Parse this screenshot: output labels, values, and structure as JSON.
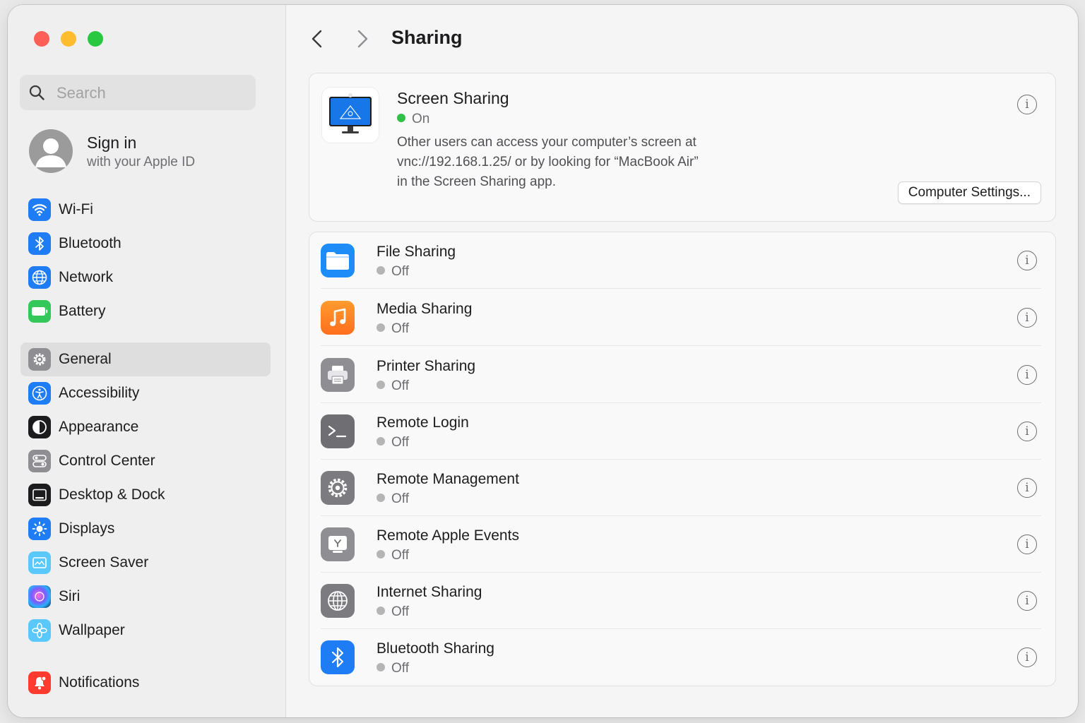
{
  "search": {
    "placeholder": "Search"
  },
  "account": {
    "name": "Sign in",
    "sub": "with your Apple ID"
  },
  "sidebar": {
    "items": [
      {
        "label": "Wi-Fi",
        "icon": "wifi-icon",
        "color": "#1e7cf5"
      },
      {
        "label": "Bluetooth",
        "icon": "bluetooth-icon",
        "color": "#1e7cf5"
      },
      {
        "label": "Network",
        "icon": "globe-icon",
        "color": "#1e7cf5"
      },
      {
        "label": "Battery",
        "icon": "battery-icon",
        "color": "#34c759"
      },
      {
        "label": "General",
        "icon": "gear-icon",
        "color": "#8e8e93",
        "selected": true
      },
      {
        "label": "Accessibility",
        "icon": "accessibility-icon",
        "color": "#1e7cf5"
      },
      {
        "label": "Appearance",
        "icon": "appearance-icon",
        "color": "#1c1c1e"
      },
      {
        "label": "Control Center",
        "icon": "control-center-icon",
        "color": "#8e8e93"
      },
      {
        "label": "Desktop & Dock",
        "icon": "dock-icon",
        "color": "#1c1c1e"
      },
      {
        "label": "Displays",
        "icon": "sun-icon",
        "color": "#1e7cf5"
      },
      {
        "label": "Screen Saver",
        "icon": "screen-saver-icon",
        "color": "#5ac8fa"
      },
      {
        "label": "Siri",
        "icon": "siri-icon",
        "color": "#5e2ca5"
      },
      {
        "label": "Wallpaper",
        "icon": "flower-icon",
        "color": "#5ac8fa"
      },
      {
        "label": "Notifications",
        "icon": "bell-icon",
        "color": "#ff3b30"
      }
    ]
  },
  "main": {
    "title": "Sharing",
    "screen_sharing": {
      "title": "Screen Sharing",
      "status": "On",
      "description": [
        "Other users can access your computer’s screen at",
        "vnc://192.168.1.25/ or by looking for “MacBook Air”",
        "in the Screen Sharing app."
      ],
      "button": "Computer Settings..."
    },
    "services": [
      {
        "title": "File Sharing",
        "status": "Off",
        "icon": "folder-icon"
      },
      {
        "title": "Media Sharing",
        "status": "Off",
        "icon": "music-note-icon"
      },
      {
        "title": "Printer Sharing",
        "status": "Off",
        "icon": "printer-icon"
      },
      {
        "title": "Remote Login",
        "status": "Off",
        "icon": "terminal-icon"
      },
      {
        "title": "Remote Management",
        "status": "Off",
        "icon": "gear-icon"
      },
      {
        "title": "Remote Apple Events",
        "status": "Off",
        "icon": "apple-events-icon"
      },
      {
        "title": "Internet Sharing",
        "status": "Off",
        "icon": "globe-icon"
      },
      {
        "title": "Bluetooth Sharing",
        "status": "Off",
        "icon": "bluetooth-icon"
      }
    ],
    "info_glyph": "i"
  }
}
